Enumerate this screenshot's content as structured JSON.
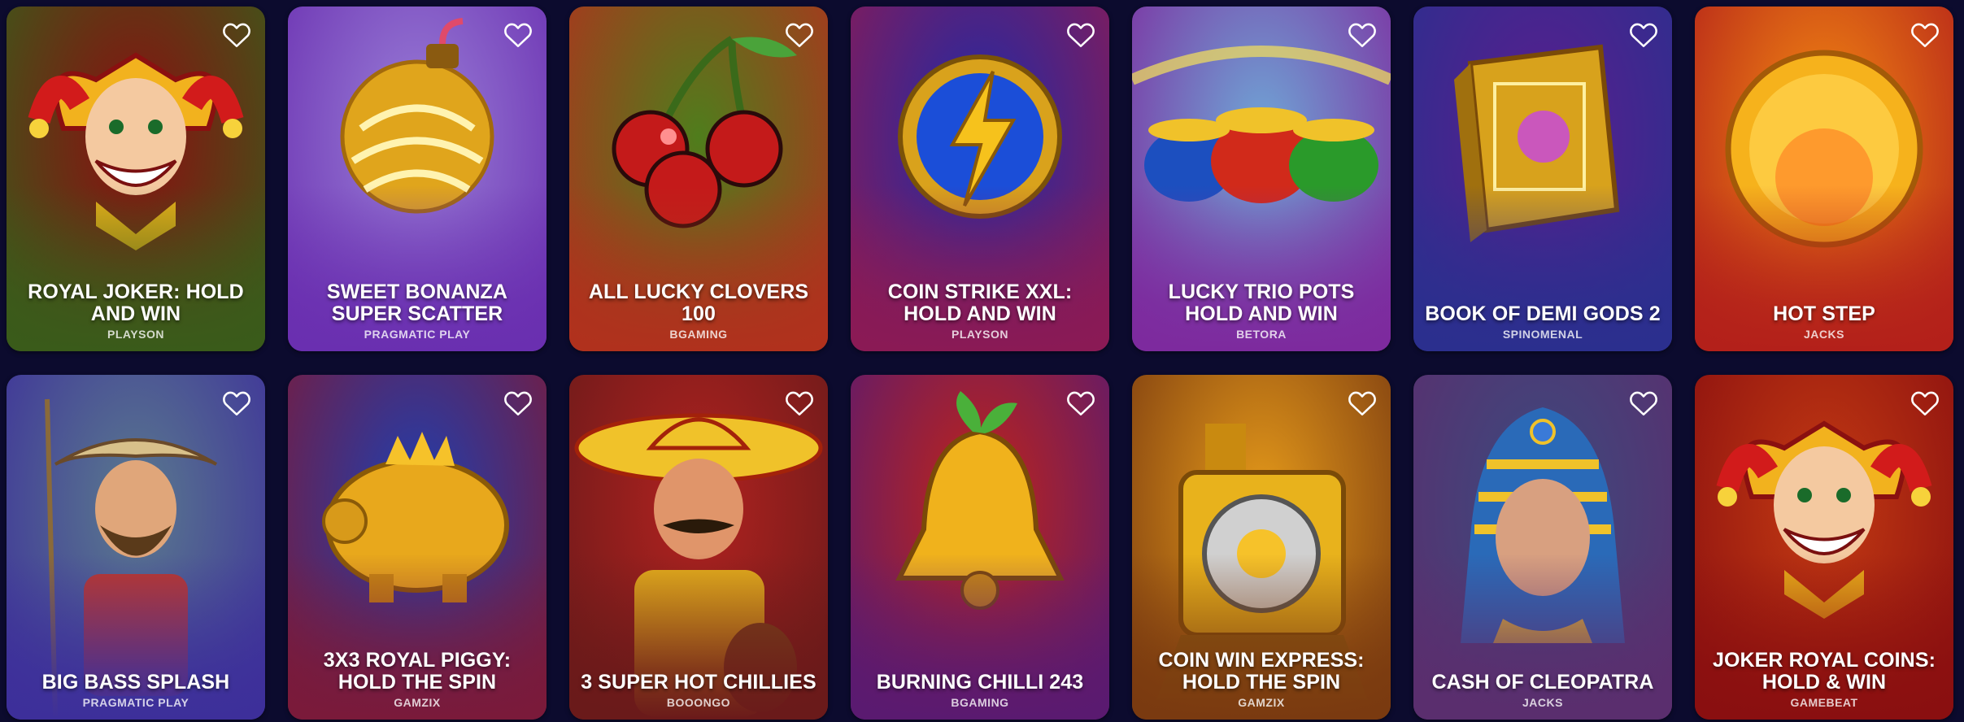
{
  "games": [
    {
      "title": "ROYAL JOKER: HOLD AND WIN",
      "provider": "PLAYSON",
      "art": "joker-icon",
      "bg1": "#8a0f10",
      "bg2": "#3a5b1a"
    },
    {
      "title": "SWEET BONANZA SUPER SCATTER",
      "provider": "PRAGMATIC PLAY",
      "art": "bomb-icon",
      "bg1": "#9a7fd8",
      "bg2": "#6a2fb0"
    },
    {
      "title": "ALL LUCKY CLOVERS 100",
      "provider": "BGAMING",
      "art": "cherry-icon",
      "bg1": "#4f7d1c",
      "bg2": "#b0311d"
    },
    {
      "title": "COIN STRIKE XXL: HOLD AND WIN",
      "provider": "PLAYSON",
      "art": "lightning-coin-icon",
      "bg1": "#1f2aa6",
      "bg2": "#8a1a55"
    },
    {
      "title": "LUCKY TRIO POTS HOLD AND WIN",
      "provider": "BETORA",
      "art": "pots-icon",
      "bg1": "#6fa6d6",
      "bg2": "#7d2a9e"
    },
    {
      "title": "BOOK OF DEMI GODS 2",
      "provider": "SPINOMENAL",
      "art": "book-icon",
      "bg1": "#5a1e8e",
      "bg2": "#2b2f8e"
    },
    {
      "title": "HOT STEP",
      "provider": "JACKS",
      "art": "sun-coin-icon",
      "bg1": "#f48a12",
      "bg2": "#b3201a"
    },
    {
      "title": "BIG BASS SPLASH",
      "provider": "PRAGMATIC PLAY",
      "art": "fisherman-icon",
      "bg1": "#5a7a8e",
      "bg2": "#3d2f9a"
    },
    {
      "title": "3X3 ROYAL PIGGY: HOLD THE SPIN",
      "provider": "GAMZIX",
      "art": "piggy-icon",
      "bg1": "#1e3fb0",
      "bg2": "#7a1a3a"
    },
    {
      "title": "3 SUPER HOT CHILLIES",
      "provider": "BOOONGO",
      "art": "mariachi-icon",
      "bg1": "#b1221f",
      "bg2": "#6a1a1a"
    },
    {
      "title": "BURNING CHILLI 243",
      "provider": "BGAMING",
      "art": "bell-icon",
      "bg1": "#c02418",
      "bg2": "#5a1a70"
    },
    {
      "title": "COIN WIN EXPRESS: HOLD THE SPIN",
      "provider": "GAMZIX",
      "art": "train-icon",
      "bg1": "#e59a1a",
      "bg2": "#7a3a10"
    },
    {
      "title": "CASH OF CLEOPATRA",
      "provider": "JACKS",
      "art": "cleopatra-icon",
      "bg1": "#3c4a7e",
      "bg2": "#5a2e6e"
    },
    {
      "title": "JOKER ROYAL COINS: HOLD & WIN",
      "provider": "GAMEBEAT",
      "art": "joker-icon",
      "bg1": "#c33a12",
      "bg2": "#8a0f10"
    }
  ]
}
